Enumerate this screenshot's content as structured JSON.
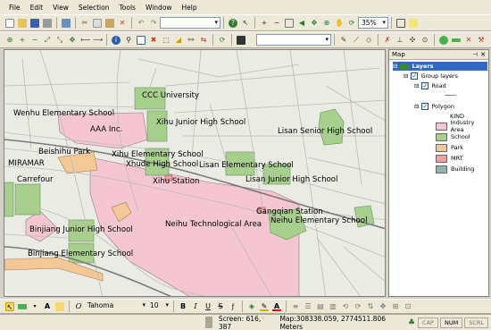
{
  "menu": [
    "File",
    "Edit",
    "View",
    "Selection",
    "Tools",
    "Window",
    "Help"
  ],
  "toolbar": {
    "zoom": "35%"
  },
  "map_labels": [
    "CCC University",
    "Wenhu Elementary School",
    "Xihu Junior High School",
    "AAA Inc.",
    "Lisan Senior High School",
    "Beishihu Park",
    "Xihu Elementary School",
    "Xhude High School",
    "Lisan Elementary School",
    "MIRAMAR",
    "Carrefour",
    "Lisan Junior High School",
    "Xihu Station",
    "Gangqian Station",
    "Neihu Elementary School",
    "Neihu Technological Area",
    "Binjiang Junior High School",
    "Binjiang Elementary School"
  ],
  "panel": {
    "title": "Map",
    "root": "Layers",
    "group": "Group layers",
    "road": "Road",
    "polygon": "Polygon",
    "kind": "KIND",
    "legend": [
      {
        "label": "Industry Area",
        "color": "#f4c6d2"
      },
      {
        "label": "School",
        "color": "#a8d08d"
      },
      {
        "label": "Park",
        "color": "#f4c896"
      },
      {
        "label": "MRT",
        "color": "#f0a0a0"
      },
      {
        "label": "Building",
        "color": "#8fb4b4"
      }
    ]
  },
  "format": {
    "font": "Tahoma",
    "size": "10"
  },
  "status": {
    "screen": "Screen: 616, 387",
    "map": "Map:308338.059, 2774511.806 Meters",
    "cap": "CAP",
    "num": "NUM",
    "scrl": "SCRL"
  }
}
